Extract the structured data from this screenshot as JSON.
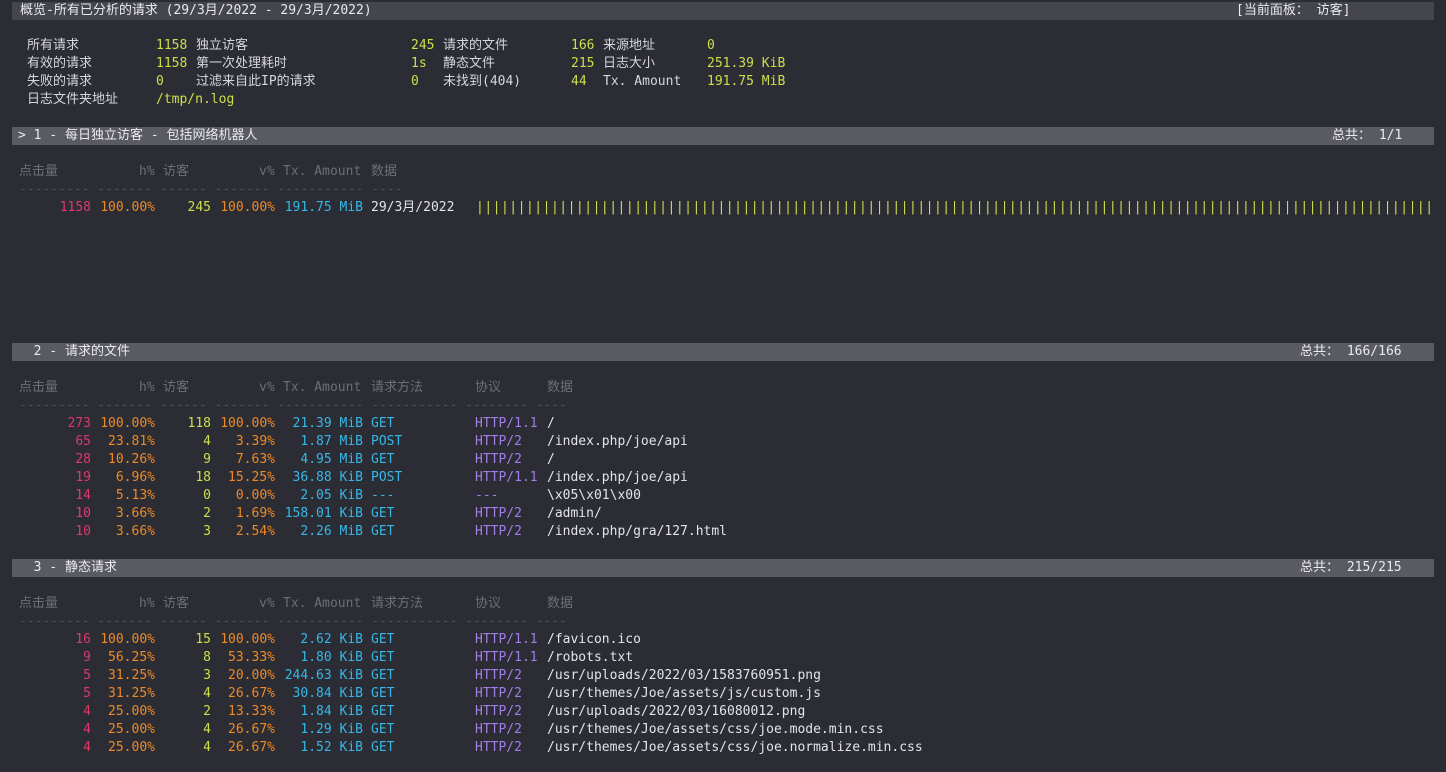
{
  "header": {
    "title": "概览-所有已分析的请求 (29/3月/2022 - 29/3月/2022)",
    "current_panel": "[当前面板： 访客]"
  },
  "overview": {
    "total_requests_label": "所有请求",
    "total_requests": "1158",
    "valid_requests_label": "有效的请求",
    "valid_requests": "1158",
    "failed_requests_label": "失败的请求",
    "failed_requests": "0",
    "log_path_label": "日志文件夹地址",
    "log_path": "/tmp/n.log",
    "unique_visitors_label": "独立访客",
    "unique_visitors": "245",
    "init_proc_label": "第一次处理耗时",
    "init_proc": "1s",
    "excluded_ip_label": "过滤来自此IP的请求",
    "excluded_ip": "0",
    "requested_files_label": "请求的文件",
    "requested_files": "166",
    "static_files_label": "静态文件",
    "static_files": "215",
    "not_found_label": "未找到(404)",
    "not_found": "44",
    "referrers_label": "来源地址",
    "referrers": "0",
    "log_size_label": "日志大小",
    "log_size": "251.39 KiB",
    "bandwidth_label": "Tx. Amount",
    "bandwidth": "191.75 MiB"
  },
  "panel1": {
    "title": "> 1 - 每日独立访客 - 包括网络机器人",
    "total": "总共： 1/1",
    "headers": {
      "hits": "点击量",
      "hpct": "h%",
      "visitors": "访客",
      "vpct": "v%",
      "tx": "Tx. Amount",
      "data": "数据"
    },
    "dashes": "--------- ------- ------ ------- ----------- ----",
    "rows": [
      {
        "hits": "1158",
        "hpct": "100.00%",
        "visitors": "245",
        "vpct": "100.00%",
        "tx": "191.75 MiB",
        "data": "29/3月/2022",
        "bar": "||||||||||||||||||||||||||||||||||||||||||||||||||||||||||||||||||||||||||||||||||||||||||||||||||||||||||||||||||||||||||||"
      }
    ]
  },
  "panel2": {
    "title": "  2 - 请求的文件",
    "total": "总共： 166/166",
    "headers": {
      "hits": "点击量",
      "hpct": "h%",
      "visitors": "访客",
      "vpct": "v%",
      "tx": "Tx. Amount",
      "method": "请求方法",
      "proto": "协议",
      "data": "数据"
    },
    "dashes": "--------- ------- ------ ------- ----------- ----------- -------- ----",
    "rows": [
      {
        "hits": "273",
        "hpct": "100.00%",
        "visitors": "118",
        "vpct": "100.00%",
        "tx": "21.39 MiB",
        "method": "GET",
        "proto": "HTTP/1.1",
        "data": "/"
      },
      {
        "hits": "65",
        "hpct": "23.81%",
        "visitors": "4",
        "vpct": "3.39%",
        "tx": "1.87 MiB",
        "method": "POST",
        "proto": "HTTP/2",
        "data": "/index.php/joe/api"
      },
      {
        "hits": "28",
        "hpct": "10.26%",
        "visitors": "9",
        "vpct": "7.63%",
        "tx": "4.95 MiB",
        "method": "GET",
        "proto": "HTTP/2",
        "data": "/"
      },
      {
        "hits": "19",
        "hpct": "6.96%",
        "visitors": "18",
        "vpct": "15.25%",
        "tx": "36.88 KiB",
        "method": "POST",
        "proto": "HTTP/1.1",
        "data": "/index.php/joe/api"
      },
      {
        "hits": "14",
        "hpct": "5.13%",
        "visitors": "0",
        "vpct": "0.00%",
        "tx": "2.05 KiB",
        "method": "---",
        "proto": "---",
        "data": "\\x05\\x01\\x00"
      },
      {
        "hits": "10",
        "hpct": "3.66%",
        "visitors": "2",
        "vpct": "1.69%",
        "tx": "158.01 KiB",
        "method": "GET",
        "proto": "HTTP/2",
        "data": "/admin/"
      },
      {
        "hits": "10",
        "hpct": "3.66%",
        "visitors": "3",
        "vpct": "2.54%",
        "tx": "2.26 MiB",
        "method": "GET",
        "proto": "HTTP/2",
        "data": "/index.php/gra/127.html"
      }
    ]
  },
  "panel3": {
    "title": "  3 - 静态请求",
    "total": "总共： 215/215",
    "headers": {
      "hits": "点击量",
      "hpct": "h%",
      "visitors": "访客",
      "vpct": "v%",
      "tx": "Tx. Amount",
      "method": "请求方法",
      "proto": "协议",
      "data": "数据"
    },
    "dashes": "--------- ------- ------ ------- ----------- ----------- -------- ----",
    "rows": [
      {
        "hits": "16",
        "hpct": "100.00%",
        "visitors": "15",
        "vpct": "100.00%",
        "tx": "2.62 KiB",
        "method": "GET",
        "proto": "HTTP/1.1",
        "data": "/favicon.ico"
      },
      {
        "hits": "9",
        "hpct": "56.25%",
        "visitors": "8",
        "vpct": "53.33%",
        "tx": "1.80 KiB",
        "method": "GET",
        "proto": "HTTP/1.1",
        "data": "/robots.txt"
      },
      {
        "hits": "5",
        "hpct": "31.25%",
        "visitors": "3",
        "vpct": "20.00%",
        "tx": "244.63 KiB",
        "method": "GET",
        "proto": "HTTP/2",
        "data": "/usr/uploads/2022/03/1583760951.png"
      },
      {
        "hits": "5",
        "hpct": "31.25%",
        "visitors": "4",
        "vpct": "26.67%",
        "tx": "30.84 KiB",
        "method": "GET",
        "proto": "HTTP/2",
        "data": "/usr/themes/Joe/assets/js/custom.js"
      },
      {
        "hits": "4",
        "hpct": "25.00%",
        "visitors": "2",
        "vpct": "13.33%",
        "tx": "1.84 KiB",
        "method": "GET",
        "proto": "HTTP/2",
        "data": "/usr/uploads/2022/03/16080012.png"
      },
      {
        "hits": "4",
        "hpct": "25.00%",
        "visitors": "4",
        "vpct": "26.67%",
        "tx": "1.29 KiB",
        "method": "GET",
        "proto": "HTTP/2",
        "data": "/usr/themes/Joe/assets/css/joe.mode.min.css"
      },
      {
        "hits": "4",
        "hpct": "25.00%",
        "visitors": "4",
        "vpct": "26.67%",
        "tx": "1.52 KiB",
        "method": "GET",
        "proto": "HTTP/2",
        "data": "/usr/themes/Joe/assets/css/joe.normalize.min.css"
      }
    ]
  }
}
